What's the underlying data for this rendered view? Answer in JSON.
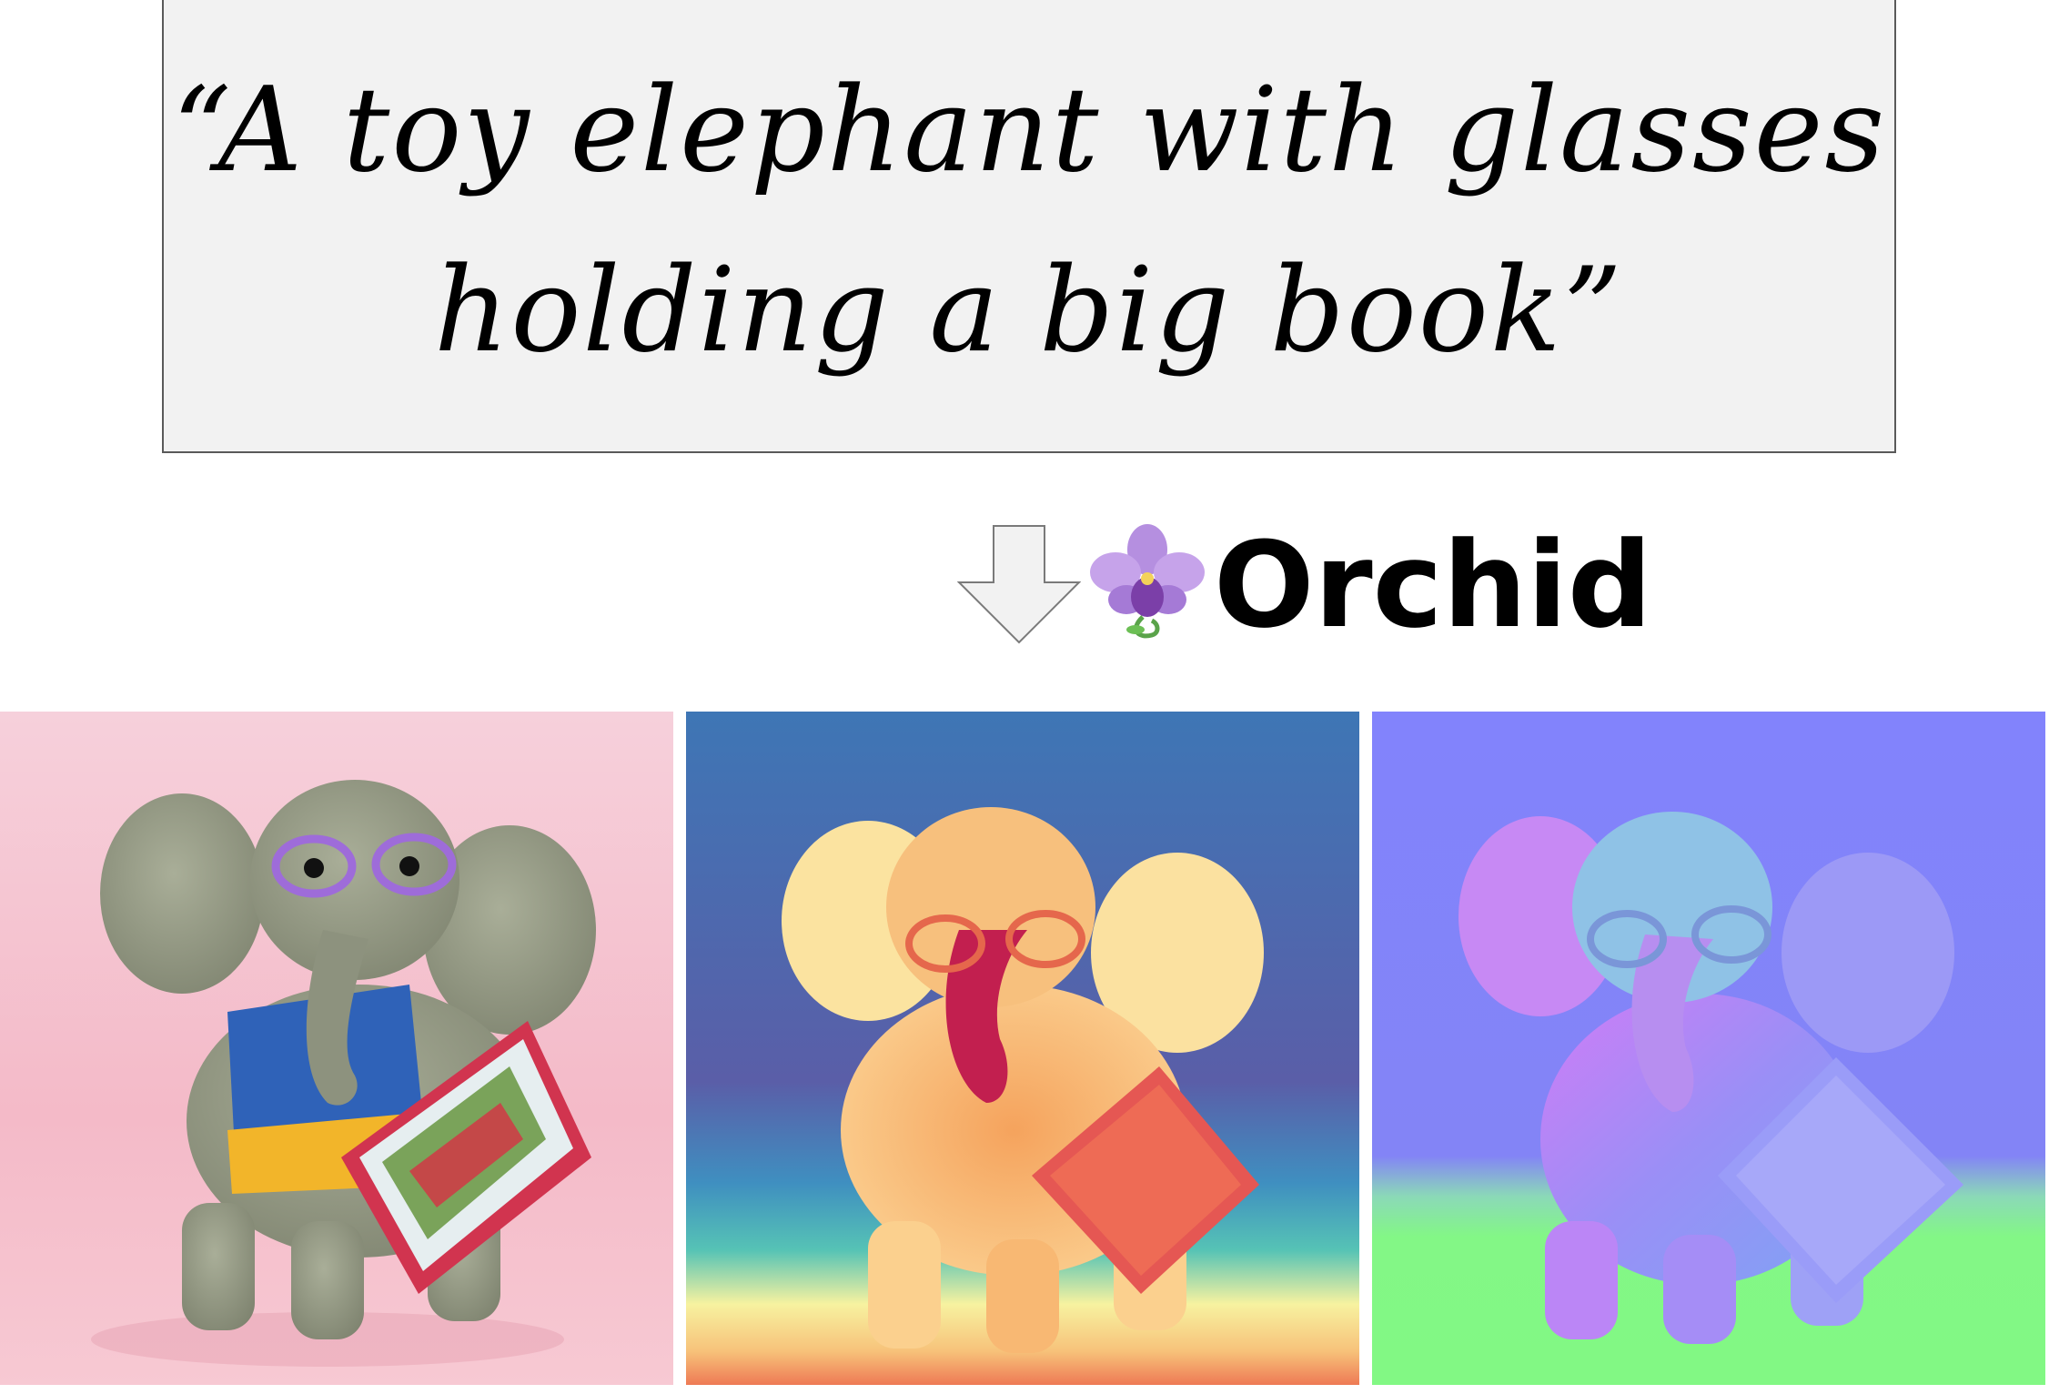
{
  "prompt": {
    "line1": "“A toy elephant with glasses",
    "line2": "holding a big book”"
  },
  "model": {
    "name": "Orchid",
    "icon": "orchid-flower-icon"
  },
  "outputs": [
    {
      "kind": "rgb",
      "icon": "elephant-rgb-image"
    },
    {
      "kind": "depth",
      "icon": "elephant-depth-map"
    },
    {
      "kind": "normal",
      "icon": "elephant-normal-map"
    }
  ],
  "colors": {
    "box_bg": "#f2f2f2",
    "box_border": "#5a5a5a",
    "arrow_fill": "#f2f2f2",
    "arrow_stroke": "#7a7a7a"
  }
}
